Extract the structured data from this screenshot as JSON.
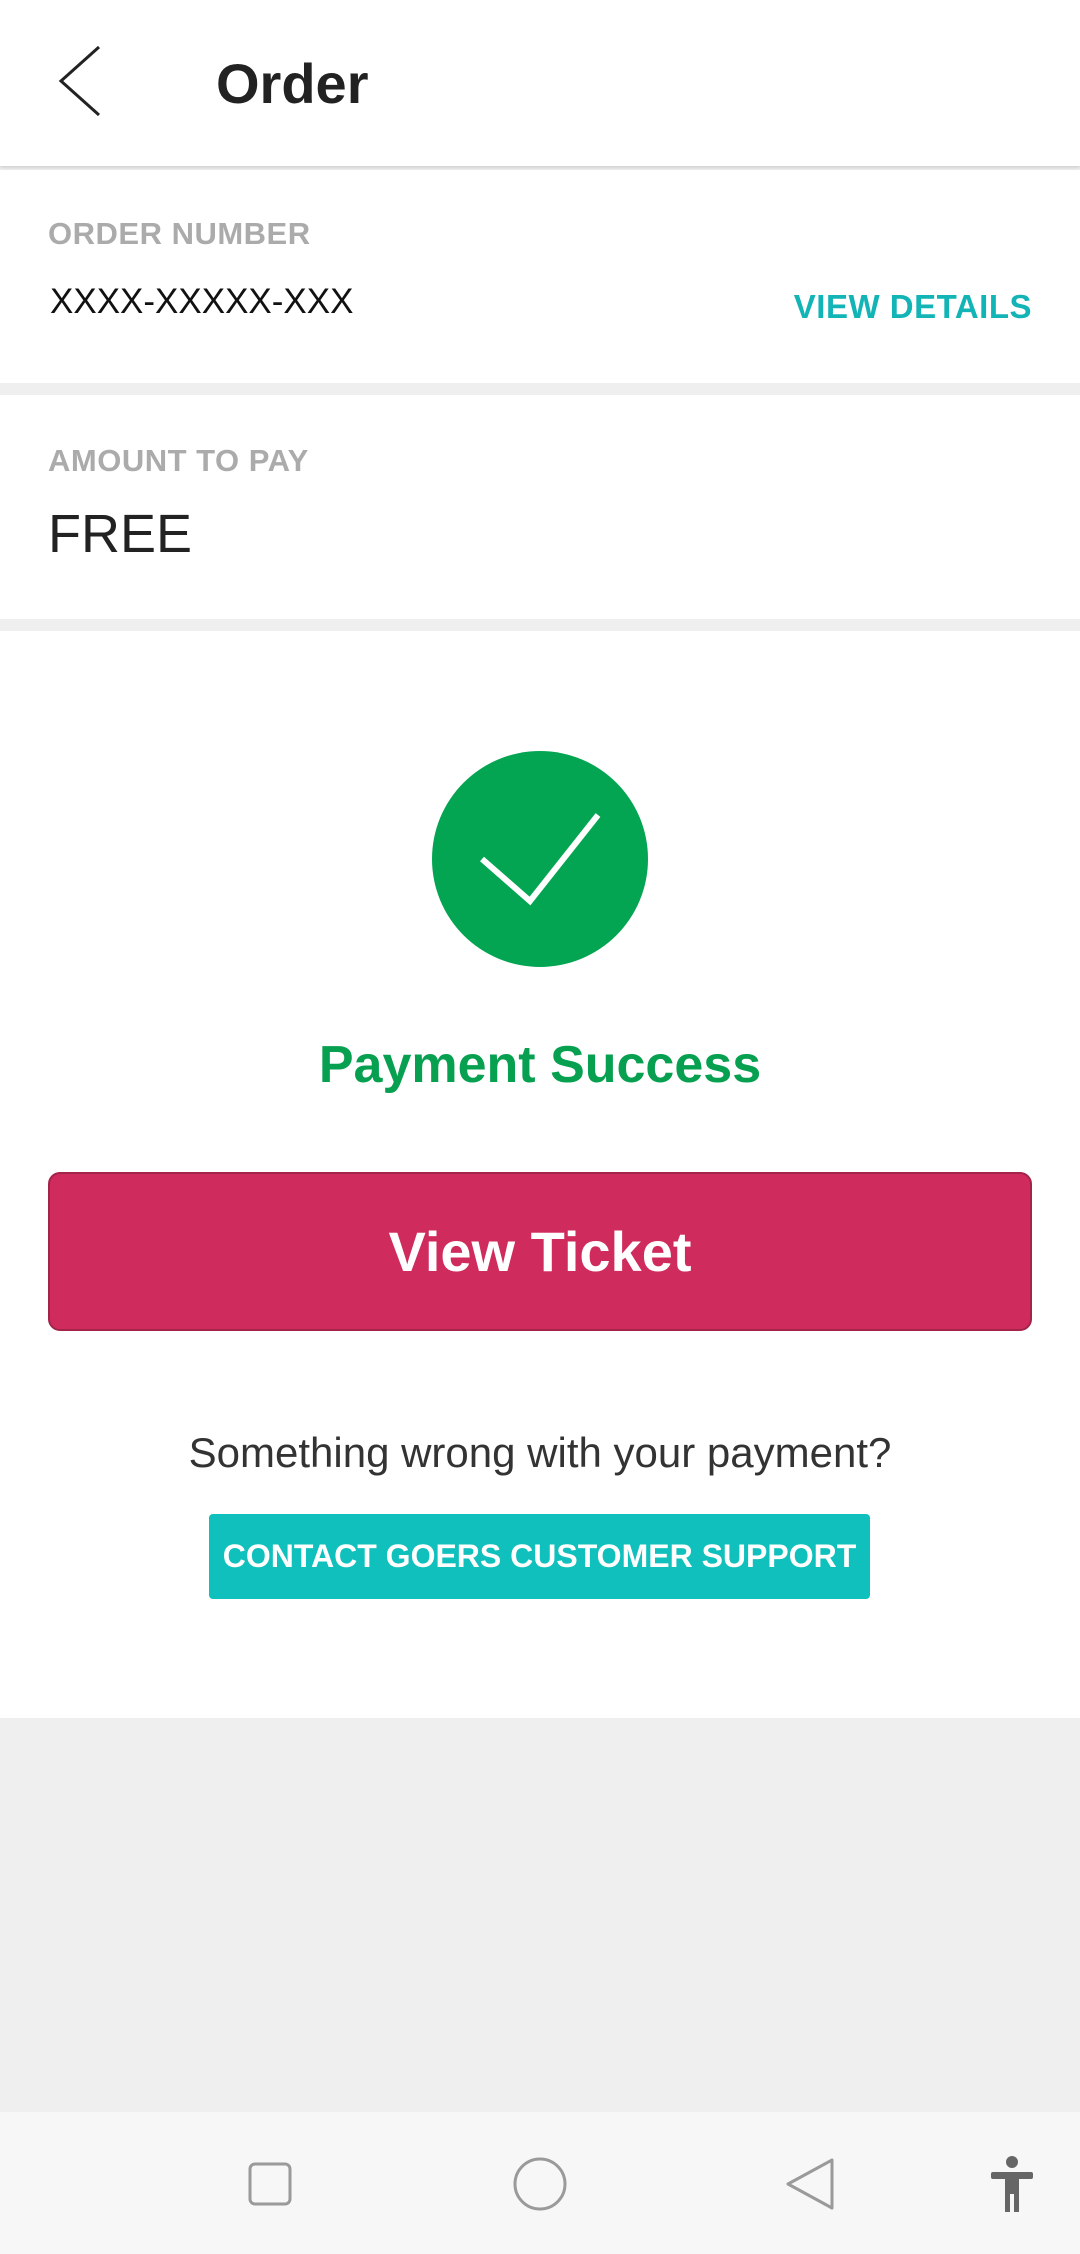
{
  "app_bar": {
    "title": "Order",
    "back_icon": "chevron-left-icon"
  },
  "order": {
    "label": "ORDER NUMBER",
    "number": "XXXX-XXXXX-XXX",
    "view_details_label": "VIEW DETAILS"
  },
  "amount": {
    "label": "AMOUNT TO PAY",
    "value": "FREE"
  },
  "status": {
    "icon": "check-circle-icon",
    "message": "Payment Success",
    "view_ticket_label": "View Ticket",
    "question": "Something wrong with your payment?",
    "support_label": "CONTACT GOERS CUSTOMER SUPPORT"
  },
  "nav_bar": {
    "icons": [
      "recent-apps-icon",
      "home-icon",
      "back-icon",
      "accessibility-icon"
    ]
  },
  "colors": {
    "success_green": "#04a552",
    "primary_button": "#cf2b5c",
    "accent_teal": "#13b4b6",
    "support_button": "#10c0bc"
  }
}
